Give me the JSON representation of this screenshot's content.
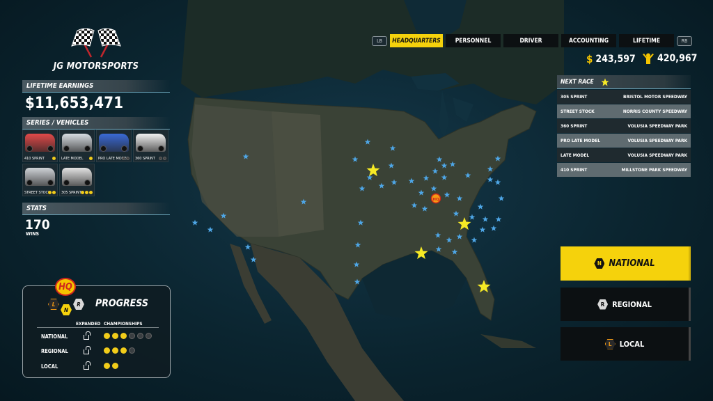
{
  "team": {
    "name": "JG MOTORSPORTS",
    "logo": "checkered-flags-icon"
  },
  "lifetime_earnings": {
    "header": "LIFETIME EARNINGS",
    "value": "$11,653,471"
  },
  "series_vehicles": {
    "header": "SERIES / VEHICLES",
    "items": [
      {
        "label": "410 SPRINT",
        "color": "#e14a4a",
        "stars": 1,
        "total": 1
      },
      {
        "label": "LATE MODEL",
        "color": "#d8dde2",
        "stars": 1,
        "total": 1
      },
      {
        "label": "PRO LATE MODEL",
        "color": "#3a6ad6",
        "stars": 0,
        "total": 2
      },
      {
        "label": "360 SPRINT",
        "color": "#f1f1f1",
        "stars": 0,
        "total": 2
      },
      {
        "label": "STREET STOCK",
        "color": "#cfd3d7",
        "stars": 2,
        "total": 2
      },
      {
        "label": "305 SPRINT",
        "color": "#e3e3e3",
        "stars": 3,
        "total": 3
      }
    ]
  },
  "stats": {
    "header": "STATS",
    "value": "170",
    "label": "WINS"
  },
  "progress": {
    "title": "PROGRESS",
    "badge_hq": "HQ",
    "badge_l": "L",
    "badge_n": "N",
    "badge_r": "R",
    "col_expanded": "EXPANDED",
    "col_championships": "CHAMPIONSHIPS",
    "rows": [
      {
        "label": "NATIONAL",
        "filled": 3,
        "total": 6
      },
      {
        "label": "REGIONAL",
        "filled": 3,
        "total": 4
      },
      {
        "label": "LOCAL",
        "filled": 2,
        "total": 2
      }
    ]
  },
  "tabs": {
    "lb": "LB",
    "rb": "RB",
    "items": [
      "HEADQUARTERS",
      "PERSONNEL",
      "DRIVER",
      "ACCOUNTING",
      "LIFETIME"
    ],
    "active": "HEADQUARTERS"
  },
  "currency": {
    "money": "243,597",
    "fans": "420,967"
  },
  "next_race": {
    "header": "NEXT RACE",
    "rows": [
      {
        "series": "305 SPRINT",
        "venue": "BRISTOL MOTOR SPEEDWAY"
      },
      {
        "series": "STREET STOCK",
        "venue": "NORRIS COUNTY SPEEDWAY"
      },
      {
        "series": "360 SPRINT",
        "venue": "VOLUSIA SPEEDWAY PARK"
      },
      {
        "series": "PRO LATE MODEL",
        "venue": "VOLUSIA SPEEDWAY PARK"
      },
      {
        "series": "LATE MODEL",
        "venue": "VOLUSIA SPEEDWAY PARK"
      },
      {
        "series": "410 SPRINT",
        "venue": "MILLSTONE PARK SPEEDWAY"
      }
    ]
  },
  "tiers": {
    "national": {
      "label": "NATIONAL",
      "icon": "N"
    },
    "regional": {
      "label": "REGIONAL",
      "icon": "R"
    },
    "local": {
      "label": "LOCAL",
      "icon": "L"
    }
  },
  "map": {
    "hq_label": "HQ"
  },
  "colors": {
    "accent_yellow": "#f5d20c",
    "track_blue": "#4ea6e6",
    "star_yellow": "#f6ea25"
  }
}
